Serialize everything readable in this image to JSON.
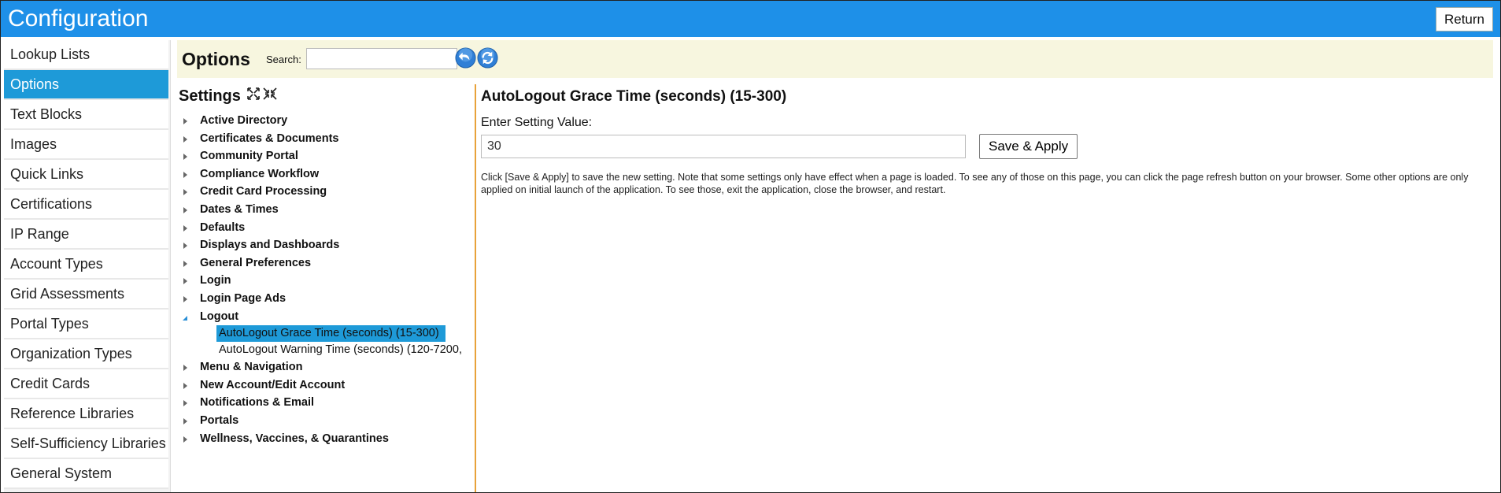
{
  "header": {
    "title": "Configuration",
    "return_label": "Return"
  },
  "sidebar": {
    "items": [
      {
        "label": "Lookup Lists"
      },
      {
        "label": "Options",
        "active": true
      },
      {
        "label": "Text Blocks"
      },
      {
        "label": "Images"
      },
      {
        "label": "Quick Links"
      },
      {
        "label": "Certifications"
      },
      {
        "label": "IP Range"
      },
      {
        "label": "Account Types"
      },
      {
        "label": "Grid Assessments"
      },
      {
        "label": "Portal Types"
      },
      {
        "label": "Organization Types"
      },
      {
        "label": "Credit Cards"
      },
      {
        "label": "Reference Libraries"
      },
      {
        "label": "Self-Sufficiency Libraries"
      },
      {
        "label": "General System"
      }
    ]
  },
  "options_bar": {
    "title": "Options",
    "search_label": "Search:",
    "search_value": ""
  },
  "settings": {
    "title": "Settings",
    "tree": [
      {
        "label": "Active Directory"
      },
      {
        "label": "Certificates & Documents"
      },
      {
        "label": "Community Portal"
      },
      {
        "label": "Compliance Workflow"
      },
      {
        "label": "Credit Card Processing"
      },
      {
        "label": "Dates & Times"
      },
      {
        "label": "Defaults"
      },
      {
        "label": "Displays and Dashboards"
      },
      {
        "label": "General Preferences"
      },
      {
        "label": "Login"
      },
      {
        "label": "Login Page Ads"
      },
      {
        "label": "Logout",
        "expanded": true,
        "children": [
          {
            "label": "AutoLogout Grace Time (seconds) (15-300)",
            "selected": true
          },
          {
            "label": "AutoLogout Warning Time (seconds) (120-7200,"
          }
        ]
      },
      {
        "label": "Menu & Navigation"
      },
      {
        "label": "New Account/Edit Account"
      },
      {
        "label": "Notifications & Email"
      },
      {
        "label": "Portals"
      },
      {
        "label": "Wellness, Vaccines, & Quarantines"
      }
    ]
  },
  "detail": {
    "title": "AutoLogout Grace Time (seconds) (15-300)",
    "value_label": "Enter Setting Value:",
    "value": "30",
    "save_label": "Save & Apply",
    "help_text": "Click [Save & Apply] to save the new setting. Note that some settings only have effect when a page is loaded. To see any of those on this page, you can click the page refresh button on your browser. Some other options are only applied on initial launch of the application. To see those, exit the application, close the browser, and restart."
  },
  "colors": {
    "header": "#1e90e8",
    "active": "#1e9ad8",
    "options_bar": "#f7f6df",
    "divider": "#e8a23a"
  },
  "icons": [
    "back-arrow-icon",
    "refresh-icon",
    "expand-all-icon",
    "collapse-all-icon",
    "tree-arrow-icon"
  ]
}
